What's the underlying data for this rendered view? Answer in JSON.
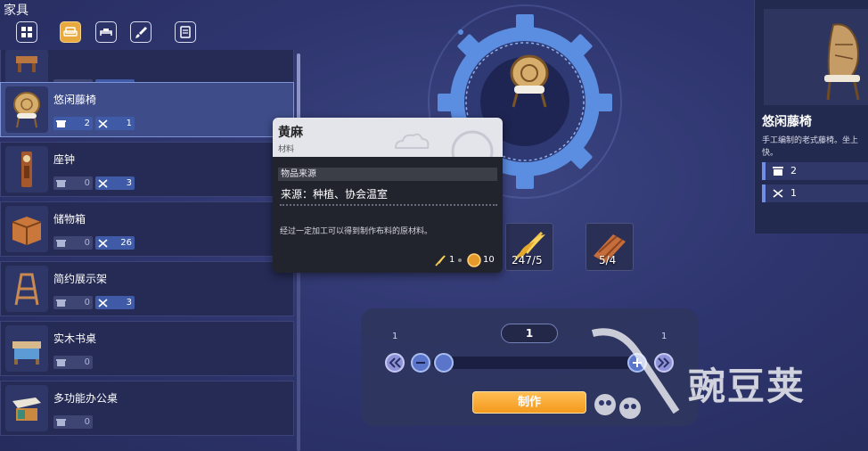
{
  "header": {
    "title": "家具",
    "tabs": [
      {
        "icon": "grid-icon",
        "active": false
      },
      {
        "icon": "sofa-icon",
        "active": true
      },
      {
        "icon": "bed-icon",
        "active": false
      },
      {
        "icon": "brush-icon",
        "active": false
      },
      {
        "icon": "cabinet-icon",
        "active": false
      }
    ]
  },
  "list": {
    "items": [
      {
        "name": "",
        "stock": "0",
        "craftable": "5",
        "icon": "stool-icon"
      },
      {
        "name": "悠闲藤椅",
        "stock": "2",
        "craftable": "1",
        "icon": "rattan-chair-icon",
        "selected": true
      },
      {
        "name": "座钟",
        "stock": "0",
        "craftable": "3",
        "icon": "clock-icon"
      },
      {
        "name": "储物箱",
        "stock": "0",
        "craftable": "26",
        "icon": "storage-box-icon"
      },
      {
        "name": "简约展示架",
        "stock": "0",
        "craftable": "3",
        "icon": "display-rack-icon"
      },
      {
        "name": "实木书桌",
        "stock": "0",
        "craftable": "",
        "icon": "desk-icon"
      },
      {
        "name": "多功能办公桌",
        "stock": "0",
        "craftable": "",
        "icon": "office-desk-icon"
      }
    ]
  },
  "tooltip": {
    "name": "黄麻",
    "type": "材料",
    "source_header": "物品来源",
    "source": "来源：种植、协会温室",
    "description": "经过一定加工可以得到制作布料的原材料。",
    "amount1": "1",
    "amount2": "10"
  },
  "materials": [
    {
      "icon": "jute-icon",
      "count": "247/5"
    },
    {
      "icon": "wood-plank-icon",
      "count": "5/4"
    }
  ],
  "craft": {
    "quantity": "1",
    "min": "1",
    "max": "1",
    "button_label": "制作",
    "slider_fraction": 0.0
  },
  "detail": {
    "name": "悠闲藤椅",
    "description": "手工编制的老式藤椅。坐上快。",
    "stock": "2",
    "craftable": "1"
  },
  "watermark": {
    "text": "豌豆荚"
  },
  "colors": {
    "accent": "#e8a93e",
    "panel": "#252b55",
    "selected": "#3e4c8a",
    "gear": "#5b8de0"
  }
}
